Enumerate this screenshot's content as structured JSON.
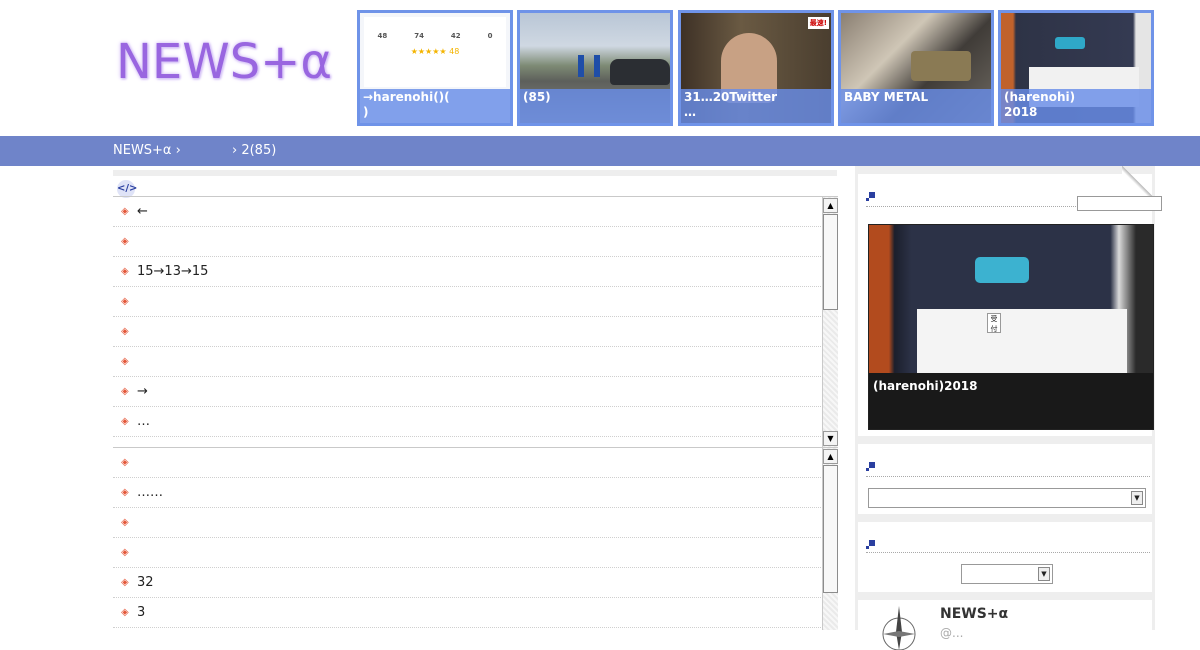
{
  "site": {
    "logo": "NEWS+α"
  },
  "header": {
    "thumbs": [
      {
        "caption": "→harenohi()(\n)",
        "stats": [
          "48",
          "74",
          "42",
          "0"
        ],
        "stars": "★★★★★ 48"
      },
      {
        "caption": "(85)"
      },
      {
        "caption": "31…20Twitter\n…",
        "tag": "最速!"
      },
      {
        "caption": "BABY METAL"
      },
      {
        "caption": "(harenohi)\n2018"
      }
    ]
  },
  "breadcrumb": {
    "home": "NEWS+α ›",
    "current": "› 2(85)"
  },
  "main": {
    "code_icon": "</>",
    "list1": [
      "←",
      "",
      "15→13→15",
      "",
      "",
      "",
      "→",
      "…"
    ],
    "list2": [
      "",
      "……",
      "",
      "",
      "32",
      "3"
    ]
  },
  "sidebar": {
    "featured_caption": "(harenohi)2018",
    "profile": {
      "name": "NEWS+α",
      "handle": "@..."
    }
  },
  "colors": {
    "nav": "#6f84c9",
    "thumb_border": "#6f93e8",
    "logo": "#9966e0",
    "bullet": "#e4583a"
  }
}
